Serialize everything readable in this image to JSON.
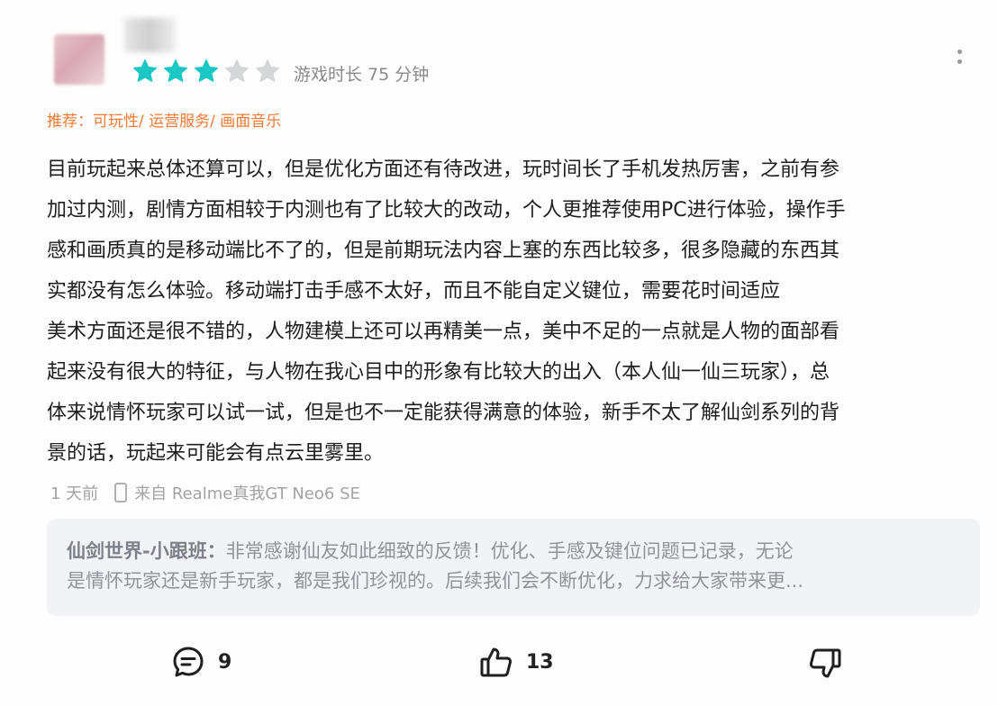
{
  "review": {
    "rating": 3,
    "max_rating": 5,
    "playtime": "游戏时长 75 分钟",
    "tags": [
      "推荐：可玩性/",
      " 运营服务/",
      " 画面音乐"
    ],
    "text": "目前玩起来总体还算可以，但是优化方面还有待改进，玩时间长了手机发热厉害，之前有参\n加过内测，剧情方面相较于内测也有了比较大的改动，个人更推荐使用PC进行体验，操作手\n感和画质真的是移动端比不了的，但是前期玩法内容上塞的东西比较多，很多隐藏的东西其\n实都没有怎么体验。移动端打击手感不太好，而且不能自定义键位，需要花时间适应\n美术方面还是很不错的，人物建模上还可以再精美一点，美中不足的一点就是人物的面部看\n起来没有很大的特征，与人物在我心目中的形象有比较大的出入（本人仙一仙三玩家），总\n体来说情怀玩家可以试一试，但是也不一定能获得满意的体验，新手不太了解仙剑系列的背\n景的话，玩起来可能会有点云里雾里。",
    "time_ago": "1 天前",
    "device": "来自 Realme真我GT Neo6 SE"
  },
  "reply": {
    "author": "仙剑世界-小跟班：",
    "line1": "非常感谢仙友如此细致的反馈！优化、手感及键位问题已记录，无论",
    "line2": "是情怀玩家还是新手玩家，都是我们珍视的。后续我们会不断优化，力求给大家带来更..."
  },
  "actions": {
    "comment_count": "9",
    "like_count": "13"
  },
  "colors": {
    "star_active": "#19c7c4",
    "star_inactive": "#d4d6da",
    "tag": "#ef7a33"
  },
  "icons": [
    "star-icon",
    "more-icon",
    "phone-icon",
    "comment-icon",
    "thumbs-up-icon",
    "thumbs-down-icon"
  ]
}
